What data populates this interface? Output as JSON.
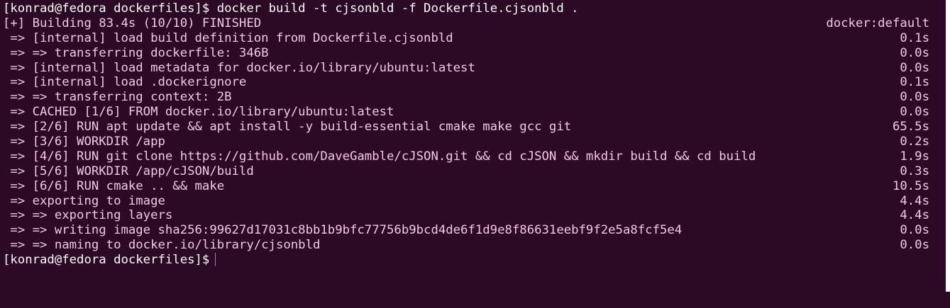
{
  "terminal": {
    "command_prompt": "[konrad@fedora dockerfiles]$",
    "command": "docker build -t cjsonbld -f Dockerfile.cjsonbld .",
    "header": {
      "text": "[+] Building 83.4s (10/10) FINISHED",
      "context": "docker:default"
    },
    "steps": [
      {
        "text": " => [internal] load build definition from Dockerfile.cjsonbld",
        "time": "0.1s"
      },
      {
        "text": " => => transferring dockerfile: 346B",
        "time": "0.0s"
      },
      {
        "text": " => [internal] load metadata for docker.io/library/ubuntu:latest",
        "time": "0.0s"
      },
      {
        "text": " => [internal] load .dockerignore",
        "time": "0.1s"
      },
      {
        "text": " => => transferring context: 2B",
        "time": "0.0s"
      },
      {
        "text": " => CACHED [1/6] FROM docker.io/library/ubuntu:latest",
        "time": "0.0s"
      },
      {
        "text": " => [2/6] RUN apt update && apt install -y build-essential cmake make gcc git",
        "time": "65.5s"
      },
      {
        "text": " => [3/6] WORKDIR /app",
        "time": "0.2s"
      },
      {
        "text": " => [4/6] RUN git clone https://github.com/DaveGamble/cJSON.git && cd cJSON && mkdir build && cd build",
        "time": "1.9s"
      },
      {
        "text": " => [5/6] WORKDIR /app/cJSON/build",
        "time": "0.3s"
      },
      {
        "text": " => [6/6] RUN cmake .. && make",
        "time": "10.5s"
      },
      {
        "text": " => exporting to image",
        "time": "4.4s"
      },
      {
        "text": " => => exporting layers",
        "time": "4.4s"
      },
      {
        "text": " => => writing image sha256:99627d17031c8bb1b9bfc77756b9bcd4de6f1d9e8f86631eebf9f2e5a8fcf5e4",
        "time": "0.0s"
      },
      {
        "text": " => => naming to docker.io/library/cjsonbld",
        "time": "0.0s"
      }
    ],
    "final_prompt": "[konrad@fedora dockerfiles]$"
  },
  "colors": {
    "background": "#2c0a25",
    "build_text": "#f2c7e8",
    "prompt_text": "#ffffff",
    "cursor": "#33cc33"
  }
}
